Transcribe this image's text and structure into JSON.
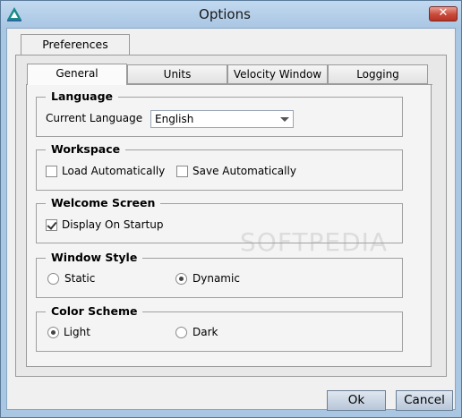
{
  "window": {
    "title": "Options",
    "close_label": "✕"
  },
  "outer_tab": {
    "label": "Preferences"
  },
  "tabs": [
    {
      "label": "General",
      "active": true
    },
    {
      "label": "Units",
      "active": false
    },
    {
      "label": "Velocity Window",
      "active": false
    },
    {
      "label": "Logging",
      "active": false
    }
  ],
  "language": {
    "title": "Language",
    "label": "Current Language",
    "value": "English"
  },
  "workspace": {
    "title": "Workspace",
    "load_label": "Load Automatically",
    "load_checked": false,
    "save_label": "Save Automatically",
    "save_checked": false
  },
  "welcome": {
    "title": "Welcome Screen",
    "display_label": "Display On Startup",
    "display_checked": true
  },
  "window_style": {
    "title": "Window Style",
    "static_label": "Static",
    "dynamic_label": "Dynamic",
    "selected": "Dynamic"
  },
  "color_scheme": {
    "title": "Color Scheme",
    "light_label": "Light",
    "dark_label": "Dark",
    "selected": "Light"
  },
  "buttons": {
    "ok": "Ok",
    "cancel": "Cancel"
  },
  "watermark": "SOFTPEDIA",
  "colors": {
    "titlebar": "#a9c6e3",
    "close": "#c8493a",
    "button": "#b7c6d8"
  }
}
